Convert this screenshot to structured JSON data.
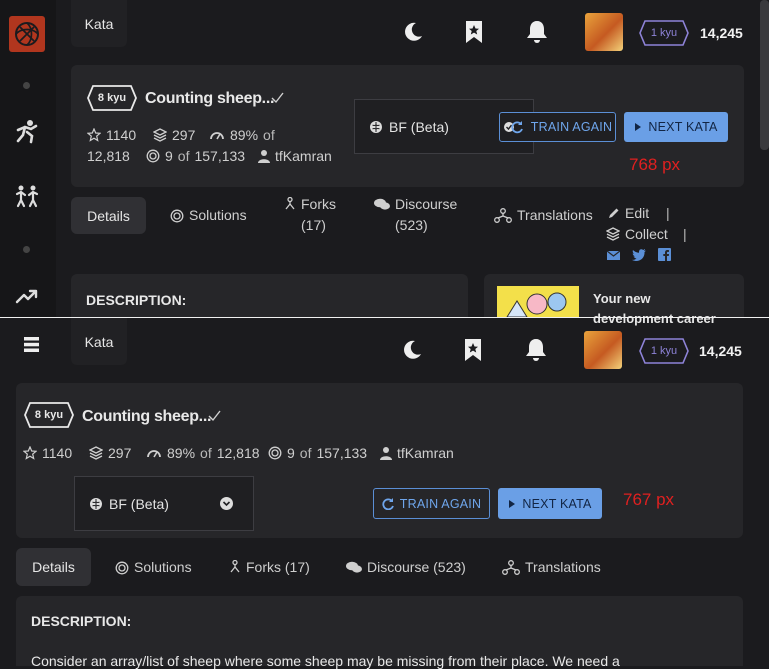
{
  "header": {
    "kata_tab": "Kata",
    "rank": "1 kyu",
    "honor": "14,245"
  },
  "kata": {
    "kyu": "8 kyu",
    "title": "Counting sheep...",
    "stars": "1140",
    "collections": "297",
    "satisfaction_pct": "89%",
    "satisfaction_of": "of",
    "satisfaction_total": "12,818",
    "completed": "9",
    "completed_of": "of",
    "completed_total": "157,133",
    "author": "tfKamran",
    "language": "BF (Beta)"
  },
  "buttons": {
    "train_again": "TRAIN AGAIN",
    "next_kata": "NEXT KATA"
  },
  "tabs": {
    "details": "Details",
    "solutions": "Solutions",
    "forks": "Forks",
    "forks_count": "(17)",
    "forks_full": "Forks (17)",
    "discourse": "Discourse",
    "discourse_count": "(523)",
    "discourse_full": "Discourse (523)",
    "translations": "Translations"
  },
  "actions": {
    "edit": "Edit",
    "collect": "Collect"
  },
  "description": {
    "heading": "DESCRIPTION:",
    "text": "Consider an array/list of sheep where some sheep may be missing from their place. We need a"
  },
  "ad": {
    "line1": "Your new",
    "line2": "development career"
  },
  "annotations": {
    "top": "768 px",
    "bottom": "767 px"
  },
  "colors": {
    "accent": "#6a9fe6",
    "rank": "#8e83d8",
    "logo": "#b1361e",
    "annotation": "#e02020"
  }
}
